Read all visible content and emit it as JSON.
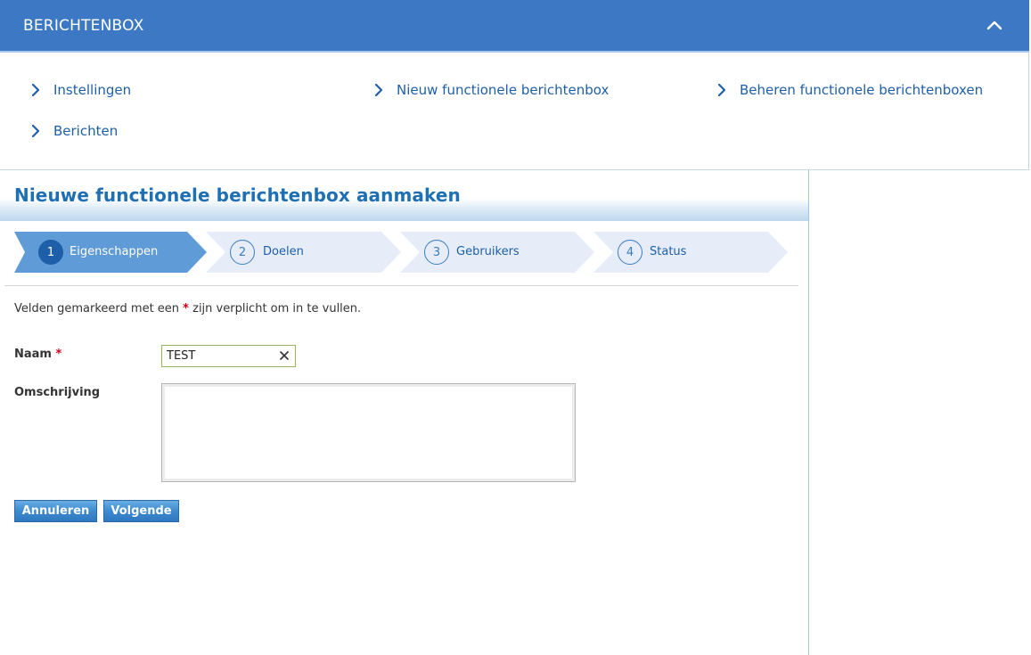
{
  "header": {
    "title": "BERICHTENBOX",
    "collapse_icon": "chevron-up-icon"
  },
  "nav": {
    "links": [
      {
        "label": "Instellingen",
        "icon": "chevron-right-icon"
      },
      {
        "label": "Nieuw functionele berichtenbox",
        "icon": "chevron-right-icon"
      },
      {
        "label": "Beheren functionele berichtenboxen",
        "icon": "chevron-right-icon"
      },
      {
        "label": "Berichten",
        "icon": "chevron-right-icon"
      }
    ]
  },
  "page": {
    "title": "Nieuwe functionele berichtenbox aanmaken"
  },
  "wizard": {
    "steps": [
      {
        "number": "1",
        "label": "Eigenschappen",
        "active": true
      },
      {
        "number": "2",
        "label": "Doelen",
        "active": false
      },
      {
        "number": "3",
        "label": "Gebruikers",
        "active": false
      },
      {
        "number": "4",
        "label": "Status",
        "active": false
      }
    ]
  },
  "form": {
    "required_note_before": "Velden gemarkeerd met een",
    "required_star": "*",
    "required_note_after": "zijn verplicht om in te vullen.",
    "name_label": "Naam",
    "name_value": "TEST",
    "description_label": "Omschrijving",
    "description_value": ""
  },
  "buttons": {
    "cancel": "Annuleren",
    "next": "Volgende"
  },
  "colors": {
    "header_bg": "#3c78c3",
    "link": "#1f5fa8",
    "title": "#1e6fb3",
    "active_step": "#5f9bd7",
    "inactive_step": "#e6edf8",
    "required": "#d0021b"
  }
}
